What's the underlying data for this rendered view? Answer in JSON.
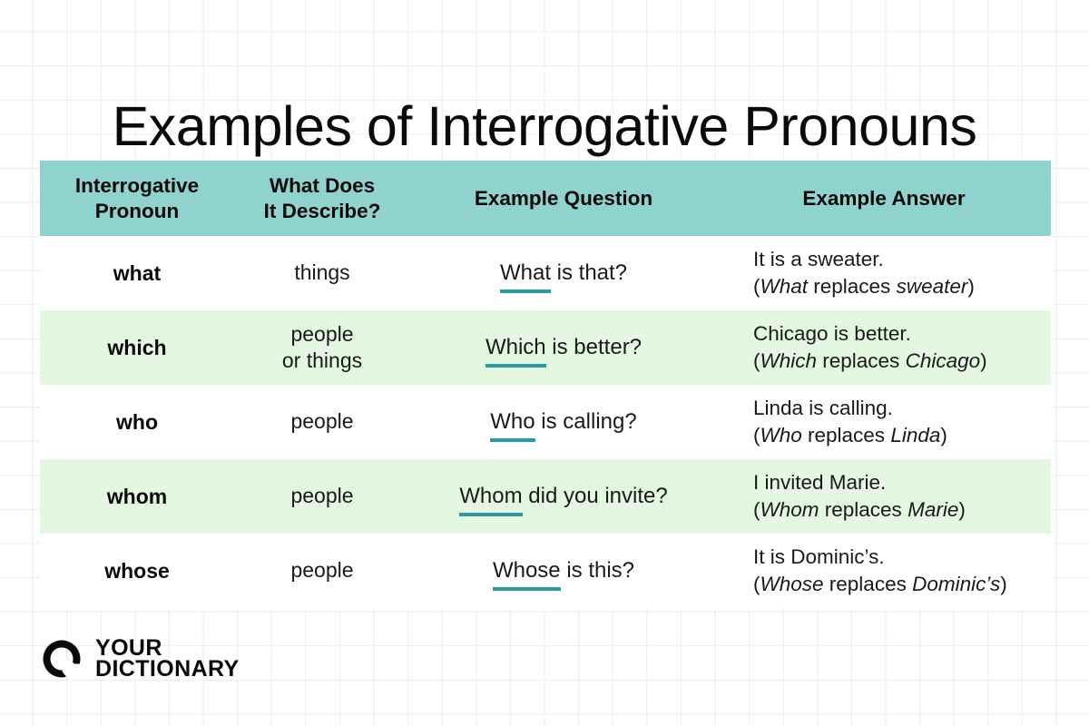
{
  "page": {
    "title": "Examples of Interrogative Pronouns",
    "background_grid_color": "#e8eef5",
    "header_bg_color": "#8fd2ce",
    "alt_row_bg_color": "#e4f7e0",
    "underline_color": "#2e9a9e",
    "divider_color": "#a9dbd8"
  },
  "table": {
    "headers": [
      {
        "line1": "Interrogative",
        "line2": "Pronoun"
      },
      {
        "line1": "What Does",
        "line2": "It Describe?"
      },
      {
        "line1": "Example Question",
        "line2": ""
      },
      {
        "line1": "Example Answer",
        "line2": ""
      }
    ],
    "rows": [
      {
        "pronoun": "what",
        "describe_line1": "things",
        "describe_line2": "",
        "question_underlined": "What",
        "question_rest": " is that?",
        "answer_line1": "It is a sweater.",
        "answer_open": "(",
        "answer_italic1": "What",
        "answer_mid": " replaces ",
        "answer_italic2": "sweater",
        "answer_close": ")"
      },
      {
        "pronoun": "which",
        "describe_line1": "people",
        "describe_line2": "or things",
        "question_underlined": "Which",
        "question_rest": " is better?",
        "answer_line1": "Chicago is better.",
        "answer_open": "(",
        "answer_italic1": "Which",
        "answer_mid": " replaces ",
        "answer_italic2": "Chicago",
        "answer_close": ")"
      },
      {
        "pronoun": "who",
        "describe_line1": "people",
        "describe_line2": "",
        "question_underlined": "Who",
        "question_rest": " is calling?",
        "answer_line1": "Linda is calling.",
        "answer_open": "(",
        "answer_italic1": "Who",
        "answer_mid": " replaces ",
        "answer_italic2": "Linda",
        "answer_close": ")"
      },
      {
        "pronoun": "whom",
        "describe_line1": "people",
        "describe_line2": "",
        "question_underlined": "Whom",
        "question_rest": " did you invite?",
        "answer_line1": "I invited Marie.",
        "answer_open": "(",
        "answer_italic1": "Whom",
        "answer_mid": " replaces ",
        "answer_italic2": "Marie",
        "answer_close": ")"
      },
      {
        "pronoun": "whose",
        "describe_line1": "people",
        "describe_line2": "",
        "question_underlined": "Whose",
        "question_rest": " is this?",
        "answer_line1": "It is Dominic’s.",
        "answer_open": "(",
        "answer_italic1": "Whose",
        "answer_mid": " replaces ",
        "answer_italic2": "Dominic’s",
        "answer_close": ")"
      }
    ]
  },
  "logo": {
    "word1": "YOUR",
    "word2": "DICTIONARY"
  }
}
